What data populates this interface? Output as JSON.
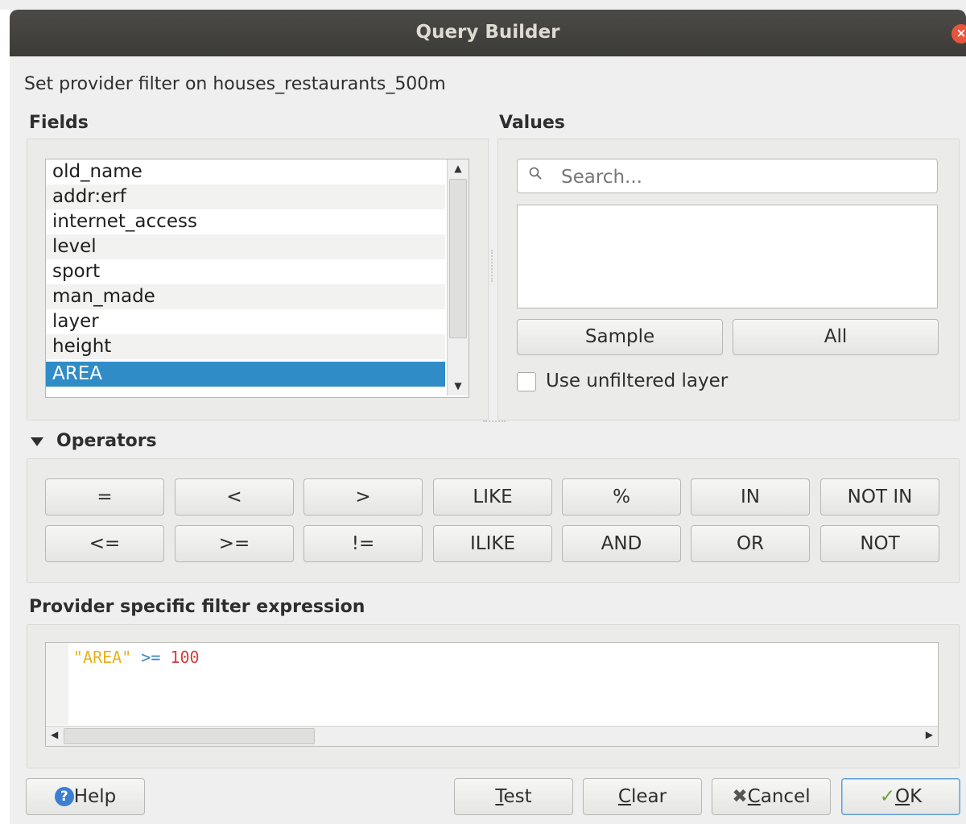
{
  "window": {
    "title": "Query Builder",
    "close_glyph": "×"
  },
  "subtitle": "Set provider filter on houses_restaurants_500m",
  "fields": {
    "heading": "Fields",
    "items": [
      "old_name",
      "addr:erf",
      "internet_access",
      "level",
      "sport",
      "man_made",
      "layer",
      "height",
      "AREA"
    ],
    "selected": "AREA",
    "scroll_up": "▲",
    "scroll_down": "▼"
  },
  "values": {
    "heading": "Values",
    "search_placeholder": "Search...",
    "sample_label": "Sample",
    "all_label": "All",
    "unfiltered_label": "Use unfiltered layer",
    "unfiltered_checked": false
  },
  "operators": {
    "heading": "Operators",
    "row1": [
      "=",
      "<",
      ">",
      "LIKE",
      "%",
      "IN",
      "NOT IN"
    ],
    "row2": [
      "<=",
      ">=",
      "!=",
      "ILIKE",
      "AND",
      "OR",
      "NOT"
    ]
  },
  "expression": {
    "heading": "Provider specific filter expression",
    "tokens": {
      "field": "\"AREA\"",
      "op": ">=",
      "value": "100"
    },
    "scroll_left": "◀",
    "scroll_right": "▶"
  },
  "buttons": {
    "help_icon": "?",
    "help": "Help",
    "test_u": "T",
    "test_rest": "est",
    "clear_u": "C",
    "clear_rest": "lear",
    "cancel_icon": "✖",
    "cancel_u": "C",
    "cancel_rest": "ancel",
    "ok_icon": "✓",
    "ok_u": "O",
    "ok_rest": "K"
  },
  "colors": {
    "selection": "#308cc6",
    "titlebar": "#3c3b37",
    "close": "#e8553b",
    "string_token": "#e8b11c",
    "operator_token": "#3b82c4",
    "number_token": "#d0413c"
  }
}
